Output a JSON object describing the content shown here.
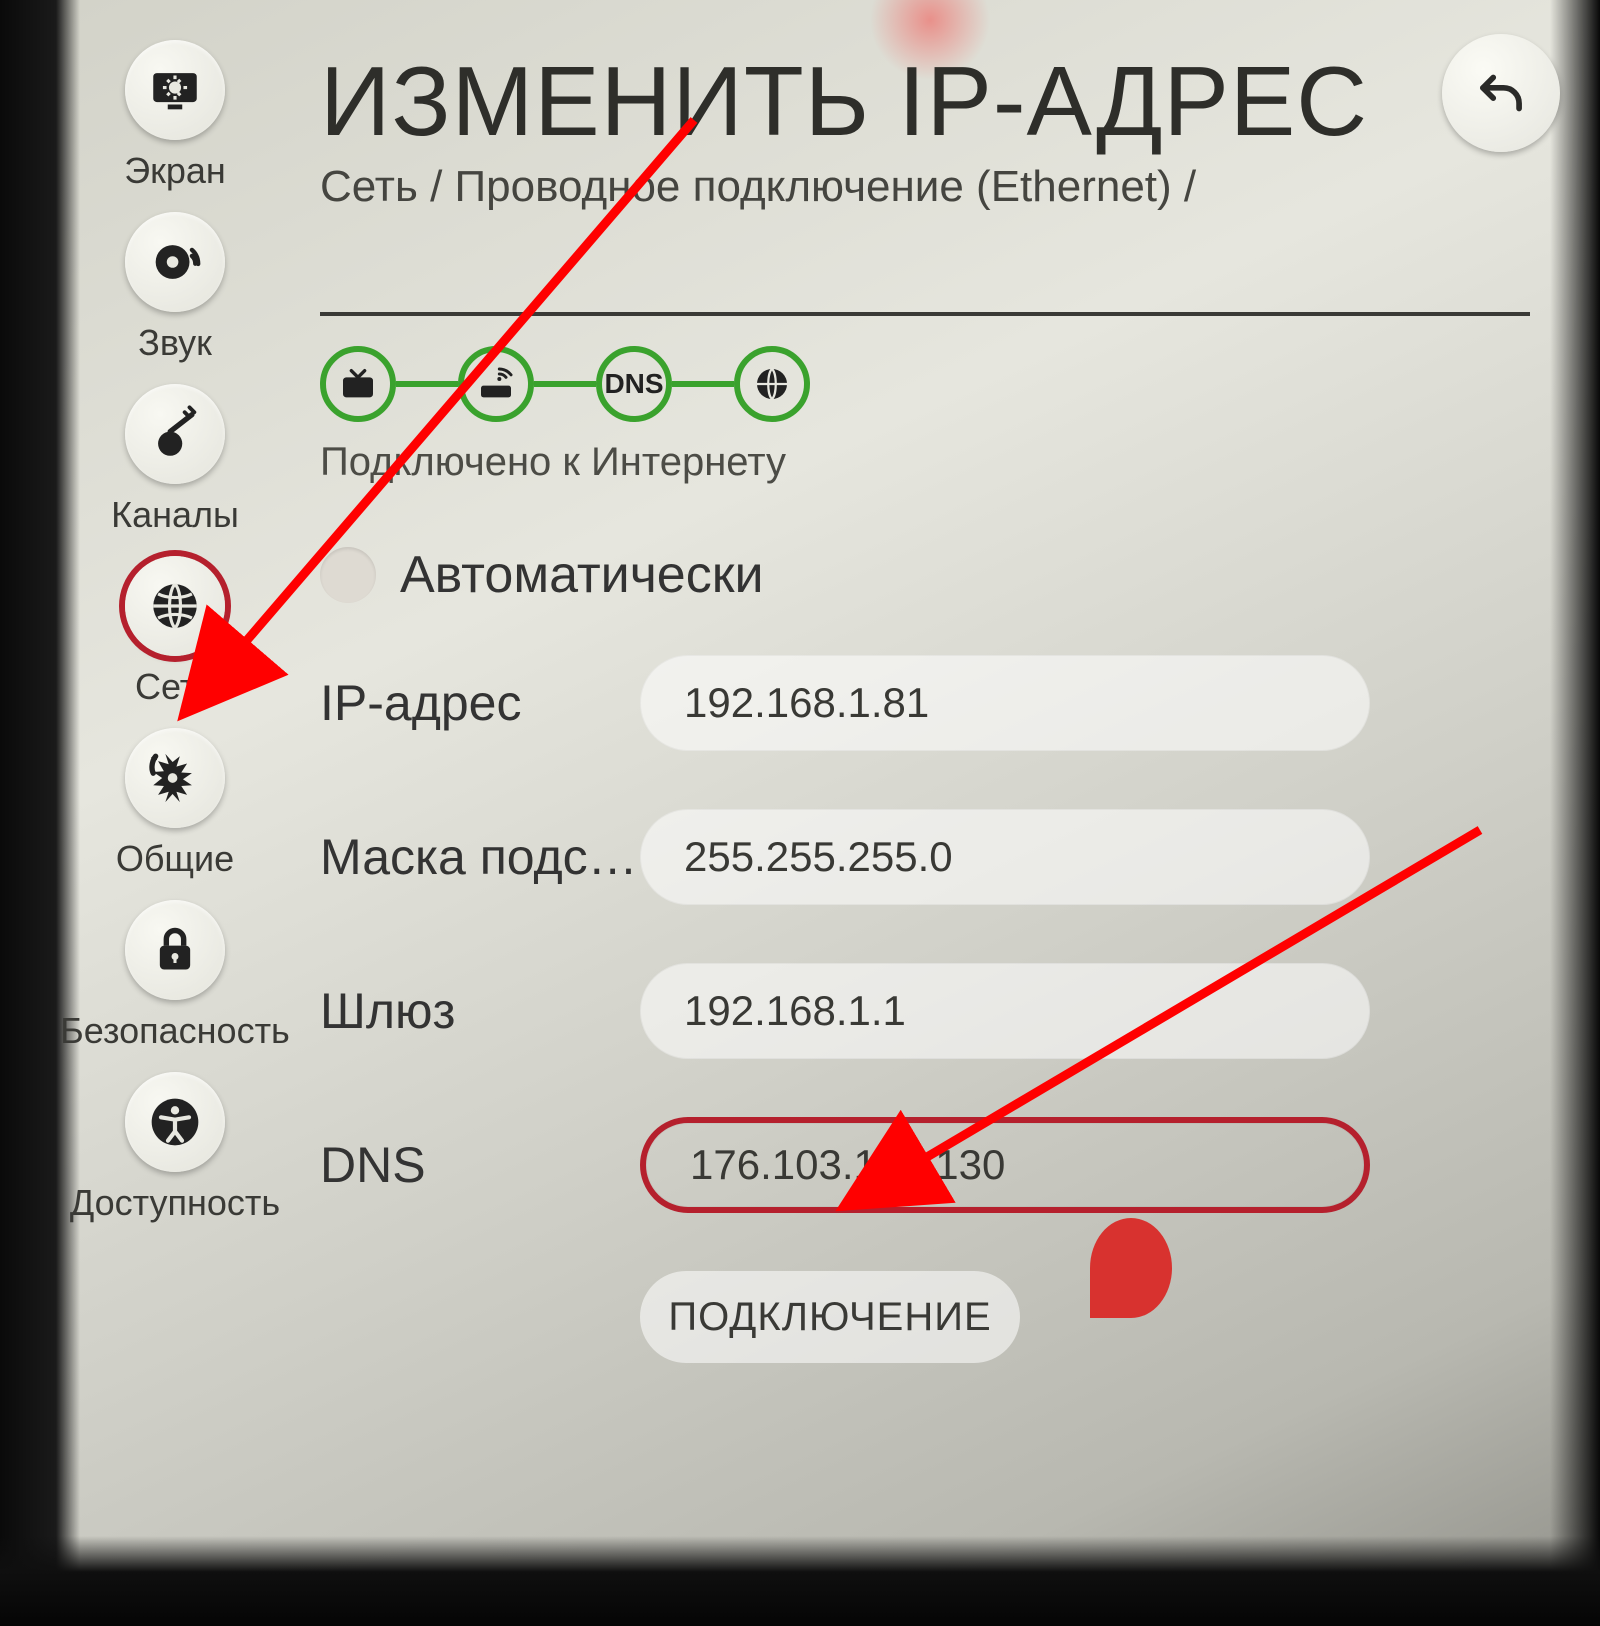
{
  "colors": {
    "accent_red": "#b5202d",
    "accent_green": "#3aa22d"
  },
  "sidebar": {
    "items": [
      {
        "label": "Экран",
        "icon": "screen-icon",
        "active": false
      },
      {
        "label": "Звук",
        "icon": "sound-icon",
        "active": false
      },
      {
        "label": "Каналы",
        "icon": "channels-icon",
        "active": false
      },
      {
        "label": "Сеть",
        "icon": "network-icon",
        "active": true
      },
      {
        "label": "Общие",
        "icon": "general-icon",
        "active": false
      },
      {
        "label": "Безопасность",
        "icon": "security-icon",
        "active": false
      },
      {
        "label": "Доступность",
        "icon": "accessibility-icon",
        "active": false
      }
    ]
  },
  "header": {
    "title": "ИЗМЕНИТЬ IP-АДРЕС",
    "breadcrumb": "Сеть / Проводное подключение (Ethernet) /"
  },
  "connection": {
    "nodes": [
      "tv",
      "router",
      "DNS",
      "internet"
    ],
    "status": "Подключено к Интернету"
  },
  "form": {
    "auto_label": "Автоматически",
    "auto_selected": false,
    "fields": [
      {
        "label": "IP-адрес",
        "value": "192.168.1.81"
      },
      {
        "label": "Маска подс…",
        "value": "255.255.255.0"
      },
      {
        "label": "Шлюз",
        "value": "192.168.1.1"
      },
      {
        "label": "DNS",
        "value": "176.103.130.130",
        "highlight": true
      }
    ],
    "connect_label": "ПОДКЛЮЧЕНИЕ"
  },
  "back_button": {
    "label": "Назад"
  }
}
